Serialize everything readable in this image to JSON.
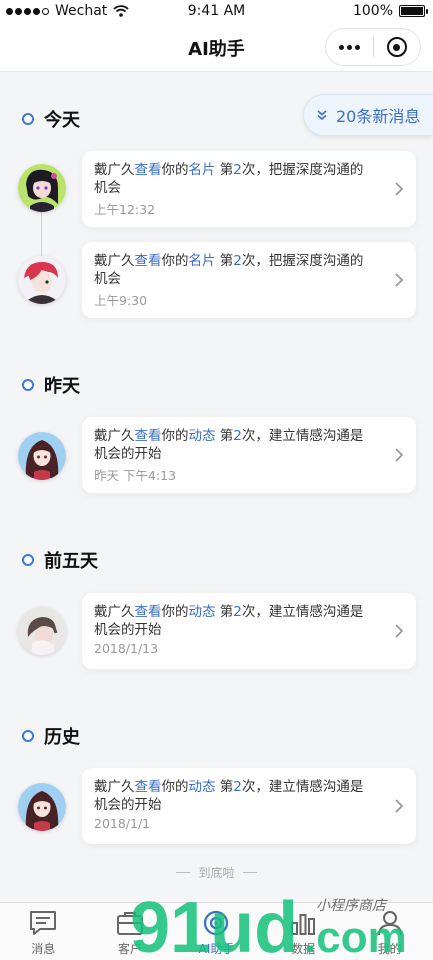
{
  "status_bar": {
    "carrier": "Wechat",
    "time": "9:41 AM",
    "battery": "100%"
  },
  "nav": {
    "title": "AI助手"
  },
  "new_messages": {
    "label": "20条新消息"
  },
  "sections": [
    {
      "title": "今天"
    },
    {
      "title": "昨天"
    },
    {
      "title": "前五天"
    },
    {
      "title": "历史"
    }
  ],
  "cards": [
    {
      "name": "戴广久",
      "action": "查看",
      "mid": "你的",
      "object": "名片",
      "ord_pre": " 第",
      "count": "2",
      "ord_post": "次，",
      "tail": "把握深度沟通的机会",
      "time": "上午12:32"
    },
    {
      "name": "戴广久",
      "action": "查看",
      "mid": "你的",
      "object": "名片",
      "ord_pre": " 第",
      "count": "2",
      "ord_post": "次，",
      "tail": "把握深度沟通的机会",
      "time": "上午9:30"
    },
    {
      "name": "戴广久",
      "action": "查看",
      "mid": "你的",
      "object": "动态",
      "ord_pre": " 第",
      "count": "2",
      "ord_post": "次，",
      "tail": "建立情感沟通是机会的开始",
      "time": "昨天  下午4:13"
    },
    {
      "name": "戴广久",
      "action": "查看",
      "mid": "你的",
      "object": "动态",
      "ord_pre": " 第",
      "count": "2",
      "ord_post": "次，",
      "tail": "建立情感沟通是机会的开始",
      "time": "2018/1/13"
    },
    {
      "name": "戴广久",
      "action": "查看",
      "mid": "你的",
      "object": "动态",
      "ord_pre": " 第",
      "count": "2",
      "ord_post": "次，",
      "tail": "建立情感沟通是机会的开始",
      "time": "2018/1/1"
    }
  ],
  "end_note": "到底啦",
  "tabs": [
    {
      "label": "消息",
      "icon": "message-icon"
    },
    {
      "label": "客户",
      "icon": "customer-icon"
    },
    {
      "label": "AI助手",
      "icon": "ai-assistant-icon",
      "active": true
    },
    {
      "label": "数据",
      "icon": "data-icon"
    },
    {
      "label": "我的",
      "icon": "profile-icon"
    }
  ],
  "watermark": {
    "text": "91ud.com",
    "subtext": "小程序商店"
  },
  "colors": {
    "accent": "#3a6fc8",
    "section_dot": "#3c78d8",
    "background": "#f4f5f7",
    "watermark": "#13c07a"
  }
}
